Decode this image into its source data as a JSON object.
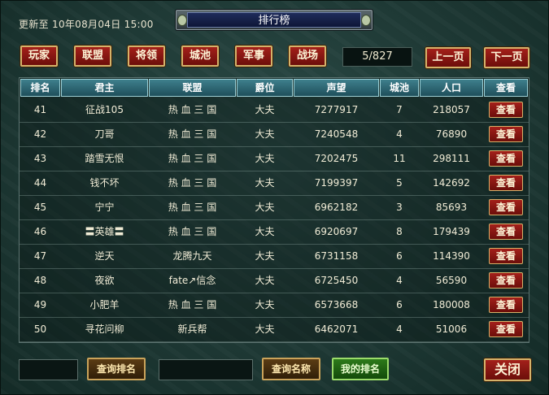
{
  "header": {
    "updated": "更新至 10年08月04日 15:00",
    "title": "排行榜"
  },
  "categories": [
    "玩家",
    "联盟",
    "将领",
    "城池",
    "军事",
    "战场"
  ],
  "pager": {
    "page": "5/827",
    "prev": "上一页",
    "next": "下一页"
  },
  "table": {
    "columns": [
      "排名",
      "君主",
      "联盟",
      "爵位",
      "声望",
      "城池",
      "人口",
      "查看"
    ],
    "view_label": "查看",
    "rows": [
      [
        "41",
        "征战105",
        "热 血 三 国",
        "大夫",
        "7277917",
        "7",
        "218057"
      ],
      [
        "42",
        "刀哥",
        "热 血 三 国",
        "大夫",
        "7240548",
        "4",
        "76890"
      ],
      [
        "43",
        "踏雪无恨",
        "热 血 三 国",
        "大夫",
        "7202475",
        "11",
        "298111"
      ],
      [
        "44",
        "钱不坏",
        "热 血 三 国",
        "大夫",
        "7199397",
        "5",
        "142692"
      ],
      [
        "45",
        "宁宁",
        "热 血 三 国",
        "大夫",
        "6962182",
        "3",
        "85693"
      ],
      [
        "46",
        "〓英雄〓",
        "热 血 三 国",
        "大夫",
        "6920697",
        "8",
        "179439"
      ],
      [
        "47",
        "逆天",
        "龙腾九天",
        "大夫",
        "6731158",
        "6",
        "114390"
      ],
      [
        "48",
        "夜欲",
        "fate↗信念",
        "大夫",
        "6725450",
        "4",
        "56590"
      ],
      [
        "49",
        "小肥羊",
        "热 血 三 国",
        "大夫",
        "6573668",
        "6",
        "180008"
      ],
      [
        "50",
        "寻花问柳",
        "新兵帮",
        "大夫",
        "6462071",
        "4",
        "51006"
      ]
    ]
  },
  "footer": {
    "query_rank": "查询排名",
    "query_name": "查询名称",
    "my_rank": "我的排名",
    "close": "关闭"
  }
}
